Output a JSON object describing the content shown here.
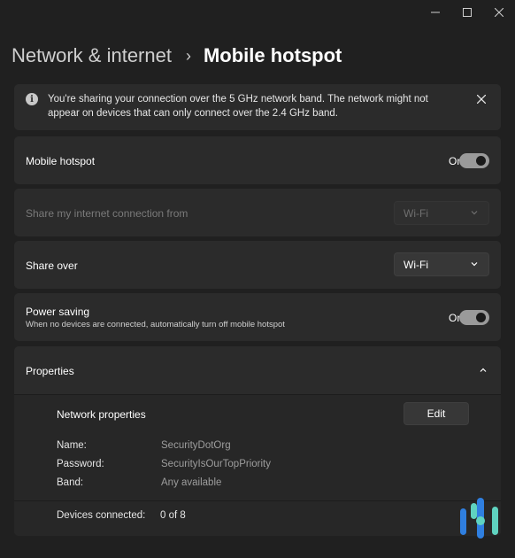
{
  "window": {
    "minimize_glyph": "—",
    "maximize_glyph": "☐",
    "close_glyph": "✕"
  },
  "breadcrumb": {
    "parent": "Network & internet",
    "separator": "›",
    "current": "Mobile hotspot"
  },
  "banner": {
    "icon": "info-icon",
    "text": "You're sharing your connection over the 5 GHz network band. The network might not appear on devices that can only connect over the 2.4 GHz band."
  },
  "mobile_hotspot": {
    "label": "Mobile hotspot",
    "state": "On"
  },
  "share_from": {
    "label": "Share my internet connection from",
    "value": "Wi-Fi"
  },
  "share_over": {
    "label": "Share over",
    "value": "Wi-Fi"
  },
  "power_saving": {
    "label": "Power saving",
    "description": "When no devices are connected, automatically turn off mobile hotspot",
    "state": "On"
  },
  "properties": {
    "label": "Properties",
    "network_properties_label": "Network properties",
    "edit_label": "Edit",
    "name_key": "Name:",
    "name_value": "SecurityDotOrg",
    "password_key": "Password:",
    "password_value": "SecurityIsOurTopPriority",
    "band_key": "Band:",
    "band_value": "Any available",
    "devices_key": "Devices connected:",
    "devices_value": "0 of 8"
  },
  "colors": {
    "background": "#202020",
    "card": "#2b2b2b",
    "toggle_on": "#9a9a9a",
    "logo_blue": "#2f7fe0",
    "logo_teal": "#5fd3c0"
  }
}
